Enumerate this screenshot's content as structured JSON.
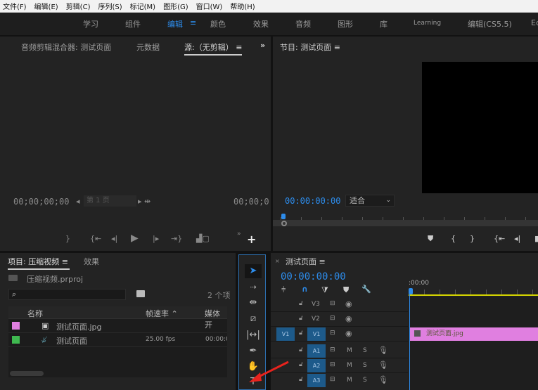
{
  "menu": [
    "文件(F)",
    "编辑(E)",
    "剪辑(C)",
    "序列(S)",
    "标记(M)",
    "图形(G)",
    "窗口(W)",
    "帮助(H)"
  ],
  "workspaces": [
    "学习",
    "组件",
    "编辑",
    "颜色",
    "效果",
    "音频",
    "图形",
    "库",
    "Learning",
    "编辑(CS5.5)",
    "Ec"
  ],
  "source": {
    "tabs": [
      "音频剪辑混合器: 测试页面",
      "元数据",
      "源:（无剪辑）"
    ],
    "tc_left": "00;00;00;00",
    "tc_right": "00;00;0",
    "page": "第 1 页",
    "more": "»"
  },
  "program": {
    "title": "节目: 测试页面",
    "timecode": "00:00:00:00",
    "zoom": "适合"
  },
  "project": {
    "tabs": [
      "项目: 压缩视频",
      "效果"
    ],
    "file": "压缩视频.prproj",
    "count": "2 个项",
    "columns": [
      "名称",
      "帧速率",
      "媒体开"
    ],
    "items": [
      {
        "name": "测试页面.jpg",
        "color": "#e07fe0",
        "fps": "",
        "start": ""
      },
      {
        "name": "测试页面",
        "color": "#3fb950",
        "fps": "25.00 fps",
        "start": "00:00:0"
      }
    ]
  },
  "timeline": {
    "title": "测试页面",
    "timecode": "00:00:00:00",
    "ruler": ":00:00",
    "clip": "测试页面.jpg",
    "video_tracks": [
      "V3",
      "V2",
      "V1"
    ],
    "audio_tracks": [
      "A1",
      "A2",
      "A3"
    ],
    "source_patch": "V1",
    "m": "M",
    "s": "S"
  },
  "colors": {
    "accent": "#2d8ceb",
    "clip": "#e07fe0",
    "workarea": "#d4d400"
  }
}
